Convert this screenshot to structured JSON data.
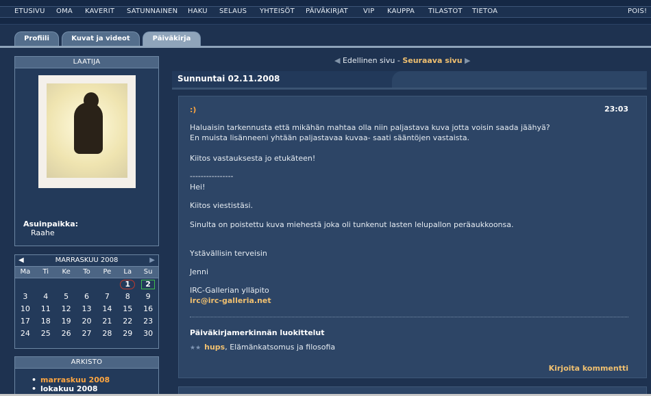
{
  "topnav": {
    "items": [
      "ETUSIVU",
      "OMA",
      "KAVERIT",
      "SATUNNAINEN",
      "HAKU",
      "SELAUS",
      "YHTEISÖT",
      "PÄIVÄKIRJAT",
      "VIP",
      "KAUPPA",
      "TILASTOT",
      "TIETOA"
    ],
    "logout": "POIS!"
  },
  "tabs": [
    "Profiili",
    "Kuvat ja videot",
    "Päiväkirja"
  ],
  "author": {
    "heading": "LAATIJA",
    "location_label": "Asuinpaikka:",
    "location_value": "Raahe"
  },
  "calendar": {
    "month": "MARRASKUU 2008",
    "days": [
      "Ma",
      "Ti",
      "Ke",
      "To",
      "Pe",
      "La",
      "Su"
    ],
    "weeks": [
      [
        "",
        "",
        "",
        "",
        "",
        "1",
        "2"
      ],
      [
        "3",
        "4",
        "5",
        "6",
        "7",
        "8",
        "9"
      ],
      [
        "10",
        "11",
        "12",
        "13",
        "14",
        "15",
        "16"
      ],
      [
        "17",
        "18",
        "19",
        "20",
        "21",
        "22",
        "23"
      ],
      [
        "24",
        "25",
        "26",
        "27",
        "28",
        "29",
        "30"
      ]
    ]
  },
  "archive": {
    "heading": "ARKISTO",
    "items": [
      "marraskuu 2008",
      "lokakuu 2008"
    ]
  },
  "pager": {
    "prev": "Edellinen sivu",
    "sep": "-",
    "next": "Seuraava sivu"
  },
  "entry": {
    "date": "Sunnuntai 02.11.2008",
    "title": ":)",
    "time": "23:03",
    "lines": [
      "Haluaisin tarkennusta että mikähän mahtaa olla niin paljastava kuva jotta voisin saada jäähyä?",
      "En muista lisänneeni yhtään paljastavaa kuvaa- saati sääntöjen vastaista.",
      "Kiitos vastauksesta jo etukäteen!",
      "----------------",
      "Hei!",
      "Kiitos viestistäsi.",
      "Sinulta on poistettu kuva miehestä joka oli tunkenut lasten lelupallon peräaukkoonsa.",
      "Ystävällisin terveisin",
      "Jenni",
      "IRC-Gallerian ylläpito"
    ],
    "email": "irc@irc-galleria.net",
    "categories_title": "Päiväkirjamerkinnän luokittelut",
    "category_tag": "hups",
    "category_rest": ", Elämänkatsomus ja filosofia",
    "comment_link": "Kirjoita kommentti"
  },
  "colors": {
    "accent_orange": "#ffa640",
    "link_gold": "#f0c070",
    "today_ring": "#c0392b",
    "selected_box": "#3fbf4f"
  }
}
